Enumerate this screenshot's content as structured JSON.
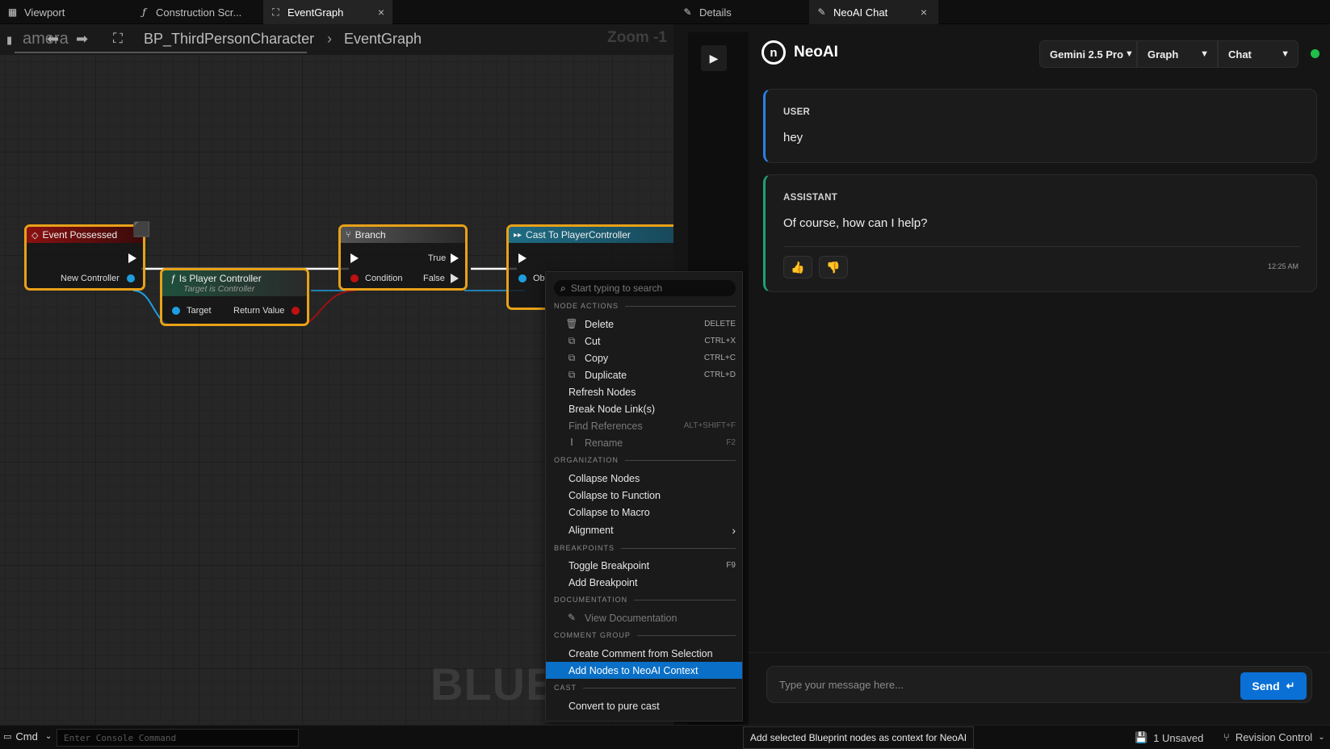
{
  "tabs": [
    {
      "label": "Viewport",
      "icon": "grid-icon"
    },
    {
      "label": "Construction Scr...",
      "icon": "function-icon"
    },
    {
      "label": "EventGraph",
      "icon": "graph-icon"
    },
    {
      "label": "Details",
      "icon": "pencil-icon"
    },
    {
      "label": "NeoAI Chat",
      "icon": "pencil-icon"
    }
  ],
  "graph": {
    "overlay_text": "amera",
    "breadcrumb_blueprint": "BP_ThirdPersonCharacter",
    "breadcrumb_graph": "EventGraph",
    "zoom": "Zoom -1",
    "watermark": "BLUE",
    "nodes": {
      "event_possessed": {
        "title": "Event Possessed",
        "pin": "New Controller"
      },
      "is_player_controller": {
        "title": "Is Player Controller",
        "subtitle": "Target is Controller",
        "pin_in": "Target",
        "pin_out": "Return Value"
      },
      "branch": {
        "title": "Branch",
        "pin_true": "True",
        "pin_false": "False",
        "pin_condition": "Condition"
      },
      "cast": {
        "title": "Cast To PlayerController",
        "pin": "Ob"
      }
    }
  },
  "context_menu": {
    "search_placeholder": "Start typing to search",
    "sections": {
      "node_actions": "NODE ACTIONS",
      "organization": "ORGANIZATION",
      "breakpoints": "BREAKPOINTS",
      "documentation": "DOCUMENTATION",
      "comment_group": "COMMENT GROUP",
      "cast": "CAST"
    },
    "items": {
      "delete": {
        "label": "Delete",
        "shortcut": "DELETE"
      },
      "cut": {
        "label": "Cut",
        "shortcut": "CTRL+X"
      },
      "copy": {
        "label": "Copy",
        "shortcut": "CTRL+C"
      },
      "duplicate": {
        "label": "Duplicate",
        "shortcut": "CTRL+D"
      },
      "refresh": {
        "label": "Refresh Nodes"
      },
      "break_links": {
        "label": "Break Node Link(s)"
      },
      "find_refs": {
        "label": "Find References",
        "shortcut": "ALT+SHIFT+F"
      },
      "rename": {
        "label": "Rename",
        "shortcut": "F2"
      },
      "collapse_nodes": {
        "label": "Collapse Nodes"
      },
      "collapse_function": {
        "label": "Collapse to Function"
      },
      "collapse_macro": {
        "label": "Collapse to Macro"
      },
      "alignment": {
        "label": "Alignment"
      },
      "toggle_bp": {
        "label": "Toggle Breakpoint",
        "shortcut": "F9"
      },
      "add_bp": {
        "label": "Add Breakpoint"
      },
      "view_docs": {
        "label": "View Documentation"
      },
      "create_comment": {
        "label": "Create Comment from Selection"
      },
      "add_neoai": {
        "label": "Add Nodes to NeoAI Context"
      },
      "pure_cast": {
        "label": "Convert to pure cast"
      }
    }
  },
  "chat": {
    "brand": "NeoAI",
    "model": "Gemini 2.5 Pro",
    "mode": "Graph",
    "view": "Chat",
    "status_color": "#1fbf4a",
    "messages": [
      {
        "role": "USER",
        "text": "hey",
        "accent": "#2b82e6"
      },
      {
        "role": "ASSISTANT",
        "text": "Of course, how can I help?",
        "time": "12:25 AM",
        "accent": "#1fa07a"
      }
    ],
    "input_placeholder": "Type your message here...",
    "send_label": "Send"
  },
  "status_bar": {
    "cmd_label": "Cmd",
    "console_placeholder": "Enter Console Command",
    "tooltip": "Add selected Blueprint nodes as context for NeoAI",
    "unsaved": "1 Unsaved",
    "revision": "Revision Control"
  }
}
